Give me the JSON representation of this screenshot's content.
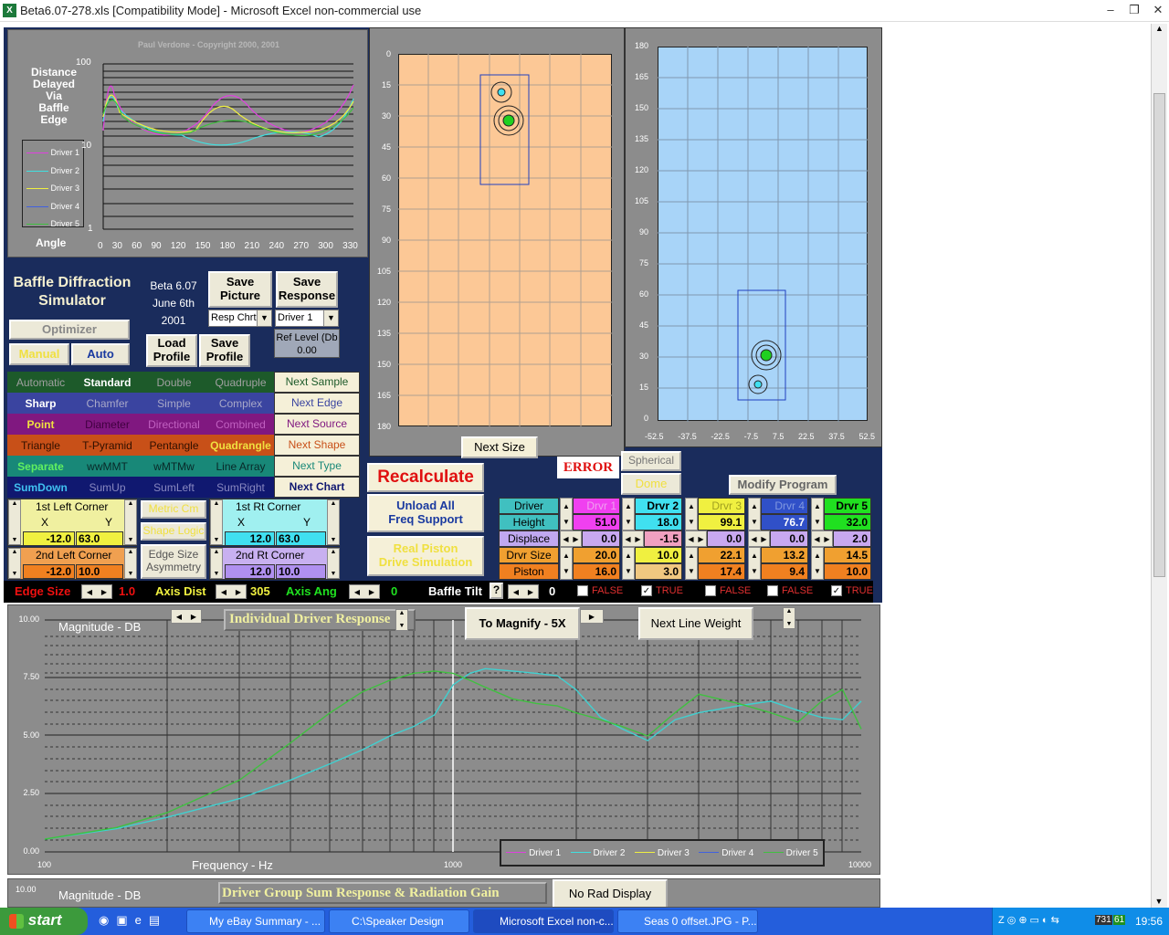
{
  "window": {
    "title": "Beta6.07-278.xls  [Compatibility Mode] - Microsoft Excel non-commercial use",
    "min": "–",
    "max": "❐",
    "close": "✕"
  },
  "polar": {
    "copyright": "Paul Verdone  -  Copyright  2000, 2001",
    "ylabel_lines": [
      "Distance",
      "Delayed",
      "Via",
      "Baffle",
      "Edge"
    ],
    "xlabel": "Angle",
    "yticks": [
      "100",
      "10",
      "1"
    ],
    "xticks": [
      "0",
      "30",
      "60",
      "90",
      "120",
      "150",
      "180",
      "210",
      "240",
      "270",
      "300",
      "330"
    ],
    "legend": [
      "Driver 1",
      "Driver 2",
      "Driver 3",
      "Driver 4",
      "Driver 5"
    ]
  },
  "app": {
    "name_l1": "Baffle Diffraction",
    "name_l2": "Simulator",
    "version": "Beta 6.07",
    "date_l1": "June 6th",
    "date_l2": "2001",
    "save_picture": "Save Picture",
    "save_response": "Save Response",
    "resp_select": "Resp Chrt",
    "driver_select": "Driver 1",
    "ref_level_label": "Ref Level (Db",
    "ref_level_value": "0.00",
    "optimizer": "Optimizer",
    "manual": "Manual",
    "auto": "Auto",
    "load_profile": "Load Profile",
    "save_profile": "Save Profile"
  },
  "grid": {
    "row1": [
      "Automatic",
      "Standard",
      "Double",
      "Quadruple"
    ],
    "row1_btn": "Next Sample",
    "row2": [
      "Sharp",
      "Chamfer",
      "Simple",
      "Complex"
    ],
    "row2_btn": "Next Edge",
    "row3": [
      "Point",
      "Diameter",
      "Directional",
      "Combined"
    ],
    "row3_btn": "Next Source",
    "row4": [
      "Triangle",
      "T-Pyramid",
      "Pentangle",
      "Quadrangle"
    ],
    "row4_btn": "Next Shape",
    "row5": [
      "Separate",
      "wwMMT",
      "wMTMw",
      "Line Array"
    ],
    "row5_btn": "Next Type",
    "row6": [
      "SumDown",
      "SumUp",
      "SumLeft",
      "SumRight"
    ],
    "row6_btn": "Next Chart"
  },
  "corners": {
    "left1": "1st Left Corner",
    "right1": "1st Rt Corner",
    "left2": "2nd Left Corner",
    "right2": "2nd Rt Corner",
    "x": "X",
    "y": "Y",
    "l1x": "-12.0",
    "l1y": "63.0",
    "r1x": "12.0",
    "r1y": "63.0",
    "l2x": "-12.0",
    "l2y": "10.0",
    "r2x": "12.0",
    "r2y": "10.0",
    "metric": "Metric Cm",
    "shape_logic": "Shape Logic",
    "edge_size_asym": "Edge Size",
    "asymmetry": "Asymmetry"
  },
  "actions": {
    "recalculate": "Recalculate",
    "unload_l1": "Unload All",
    "unload_l2": "Freq Support",
    "real_l1": "Real Piston",
    "real_l2": "Drive Simulation",
    "next_size": "Next Size",
    "error": "ERROR",
    "spherical": "Spherical",
    "dome": "Dome",
    "modify_program": "Modify Program"
  },
  "baffle_front": {
    "yticks": [
      "0",
      "15",
      "30",
      "45",
      "60",
      "75",
      "90",
      "105",
      "120",
      "135",
      "150",
      "165",
      "180"
    ]
  },
  "baffle_side": {
    "yticks": [
      "180",
      "165",
      "150",
      "135",
      "120",
      "105",
      "90",
      "75",
      "60",
      "45",
      "30",
      "15",
      "0"
    ],
    "xticks": [
      "-52.5",
      "-37.5",
      "-22.5",
      "-7.5",
      "7.5",
      "22.5",
      "37.5",
      "52.5"
    ]
  },
  "drivers": {
    "row_labels": [
      "Driver",
      "Height",
      "Displace",
      "Drvr Size",
      "Piston"
    ],
    "cols": [
      {
        "name": "Drvr 1",
        "height": "51.0",
        "displace": "0.0",
        "size": "20.0",
        "piston": "16.0"
      },
      {
        "name": "Drvr 2",
        "height": "18.0",
        "displace": "-1.5",
        "size": "10.0",
        "piston": "3.0"
      },
      {
        "name": "Drvr 3",
        "height": "99.1",
        "displace": "0.0",
        "size": "22.1",
        "piston": "17.4"
      },
      {
        "name": "Drvr 4",
        "height": "76.7",
        "displace": "0.0",
        "size": "13.2",
        "piston": "9.4"
      },
      {
        "name": "Drvr 5",
        "height": "32.0",
        "displace": "2.0",
        "size": "14.5",
        "piston": "10.0"
      }
    ],
    "enabled": [
      "FALSE",
      "TRUE",
      "FALSE",
      "FALSE",
      "TRUE"
    ]
  },
  "params": {
    "edge_size_label": "Edge Size",
    "edge_size": "1.0",
    "axis_dist_label": "Axis Dist",
    "axis_dist": "305",
    "axis_ang_label": "Axis Ang",
    "axis_ang": "0",
    "baffle_tilt_label": "Baffle Tilt",
    "baffle_tilt": "0",
    "help": "?"
  },
  "response": {
    "title": "Individual Driver Response",
    "ylabel": "Magnitude  -  DB",
    "xlabel": "Frequency  -  Hz",
    "magnify": "To Magnify - 5X",
    "next_line_weight": "Next Line Weight",
    "yticks": [
      "10.00",
      "7.50",
      "5.00",
      "2.50",
      "0.00"
    ],
    "xticks": [
      "100",
      "1000",
      "10000"
    ],
    "legend": [
      "Driver 1",
      "Driver 2",
      "Driver 3",
      "Driver 4",
      "Driver 5"
    ]
  },
  "sum_chart": {
    "ylabel": "Magnitude  -  DB",
    "ytick": "10.00",
    "title": "Driver Group Sum Response  &  Radiation Gain",
    "no_rad": "No Rad Display"
  },
  "chart_data": {
    "type": "line",
    "xlabel": "Frequency  -  Hz",
    "ylabel": "Magnitude  -  DB",
    "title": "Individual Driver Response",
    "xscale": "log",
    "xlim": [
      100,
      10000
    ],
    "ylim": [
      0,
      10
    ],
    "series": [
      {
        "name": "Driver 2",
        "color": "#40d0d0",
        "x": [
          100,
          150,
          200,
          300,
          400,
          500,
          600,
          700,
          800,
          900,
          1000,
          1100,
          1200,
          1400,
          1600,
          1800,
          2000,
          2300,
          2600,
          3000,
          3500,
          4000,
          5000,
          6000,
          7000,
          8000,
          9000,
          10000
        ],
        "y": [
          0.55,
          1.0,
          1.5,
          2.3,
          3.1,
          3.8,
          4.4,
          5.0,
          5.4,
          5.9,
          7.2,
          7.7,
          7.9,
          7.8,
          7.7,
          7.6,
          7.0,
          5.8,
          5.3,
          4.8,
          5.7,
          6.0,
          6.3,
          6.5,
          6.1,
          5.8,
          5.7,
          6.5
        ]
      },
      {
        "name": "Driver 5",
        "color": "#40c040",
        "x": [
          100,
          150,
          200,
          300,
          400,
          500,
          600,
          700,
          800,
          900,
          1000,
          1100,
          1200,
          1400,
          1600,
          1800,
          2000,
          2300,
          2600,
          3000,
          3500,
          4000,
          5000,
          6000,
          7000,
          8000,
          9000,
          10000
        ],
        "y": [
          0.55,
          1.05,
          1.7,
          3.1,
          4.7,
          6.0,
          6.9,
          7.4,
          7.7,
          7.8,
          7.7,
          7.4,
          7.1,
          6.6,
          6.4,
          6.3,
          6.0,
          5.7,
          5.4,
          5.0,
          6.0,
          6.8,
          6.4,
          6.0,
          5.6,
          6.5,
          7.0,
          5.3
        ]
      }
    ]
  },
  "taskbar": {
    "start": "start",
    "items": [
      "My eBay Summary - ...",
      "C:\\Speaker Design",
      "Microsoft Excel non-c...",
      "Seas 0 offset.JPG - P..."
    ],
    "clock": "19:56",
    "tray1": "731",
    "tray2": "61"
  }
}
